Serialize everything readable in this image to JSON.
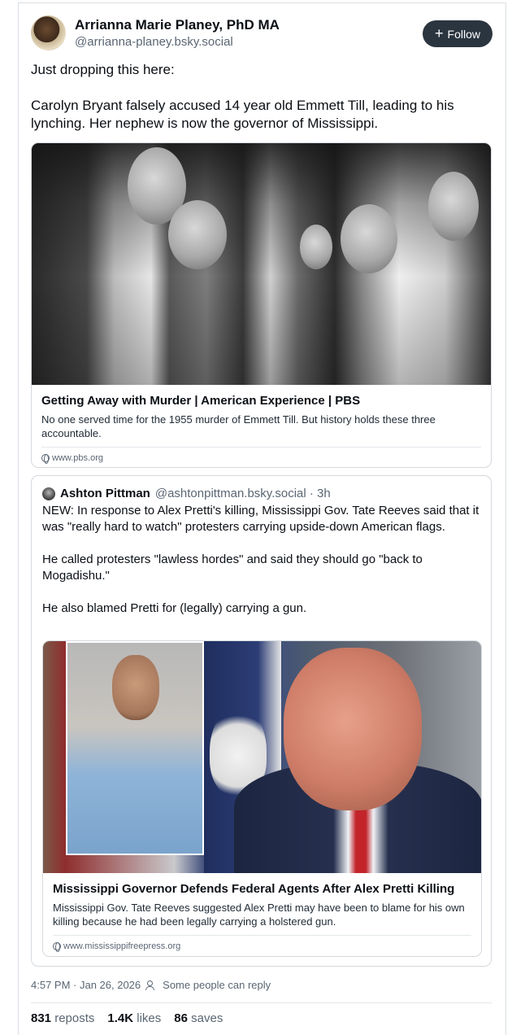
{
  "post": {
    "author_name": "Arrianna Marie Planey, PhD MA",
    "author_handle": "@arrianna-planey.bsky.social",
    "follow_label": "Follow",
    "text_line1": "Just dropping this here:",
    "text_line2": "Carolyn Bryant falsely accused 14 year old Emmett Till, leading to his lynching. Her nephew is now the governor of Mississippi."
  },
  "link_card": {
    "title": "Getting Away with Murder | American Experience | PBS",
    "description": "No one served time for the 1955 murder of Emmett Till. But history holds these three accountable.",
    "domain": "www.pbs.org"
  },
  "quote": {
    "author_name": "Ashton Pittman",
    "author_handle": "@ashtonpittman.bsky.social · 3h",
    "para1": "NEW: In response to Alex Pretti's killing, Mississippi Gov. Tate Reeves said that it was \"really hard to watch\" protesters carrying upside-down American flags.",
    "para2": "He called protesters \"lawless hordes\" and said they should go \"back to Mogadishu.\"",
    "para3": "He also blamed Pretti for (legally) carrying a gun.",
    "link_card": {
      "title": "Mississippi Governor Defends Federal Agents After Alex Pretti Killing",
      "description": "Mississippi Gov. Tate Reeves suggested Alex Pretti may have been to blame for his own killing because he had been legally carrying a holstered gun.",
      "domain": "www.mississippifreepress.org"
    }
  },
  "meta": {
    "timestamp": "4:57 PM · Jan 26, 2026",
    "reply_setting": "Some people can reply"
  },
  "stats": {
    "reposts_count": "831",
    "reposts_label": "reposts",
    "likes_count": "1.4K",
    "likes_label": "likes",
    "saves_count": "86",
    "saves_label": "saves"
  },
  "icons": {
    "follow": "plus-icon",
    "domain": "globe-icon",
    "reply_setting": "people-icon"
  }
}
